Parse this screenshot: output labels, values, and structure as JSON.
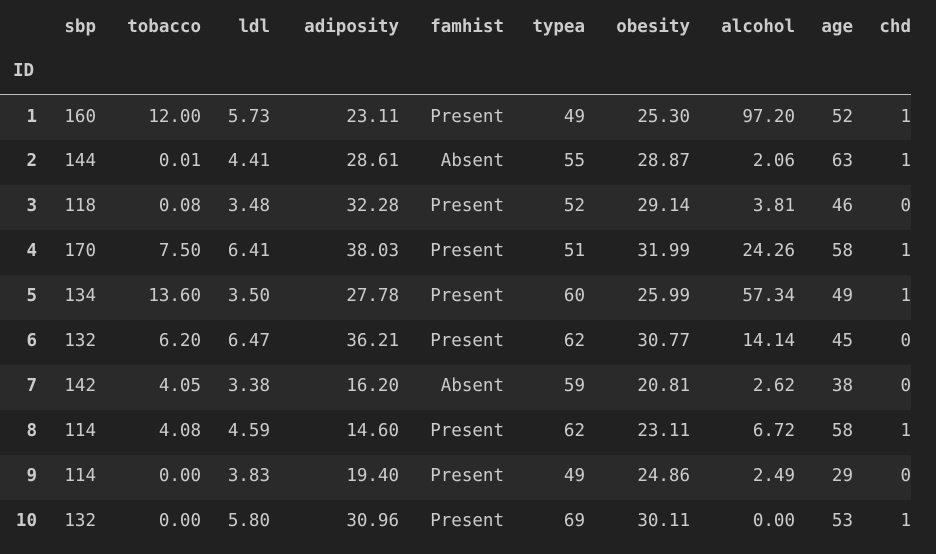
{
  "index_name": "ID",
  "columns": [
    "sbp",
    "tobacco",
    "ldl",
    "adiposity",
    "famhist",
    "typea",
    "obesity",
    "alcohol",
    "age",
    "chd"
  ],
  "rows": [
    {
      "id": "1",
      "sbp": "160",
      "tobacco": "12.00",
      "ldl": "5.73",
      "adiposity": "23.11",
      "famhist": "Present",
      "typea": "49",
      "obesity": "25.30",
      "alcohol": "97.20",
      "age": "52",
      "chd": "1"
    },
    {
      "id": "2",
      "sbp": "144",
      "tobacco": "0.01",
      "ldl": "4.41",
      "adiposity": "28.61",
      "famhist": "Absent",
      "typea": "55",
      "obesity": "28.87",
      "alcohol": "2.06",
      "age": "63",
      "chd": "1"
    },
    {
      "id": "3",
      "sbp": "118",
      "tobacco": "0.08",
      "ldl": "3.48",
      "adiposity": "32.28",
      "famhist": "Present",
      "typea": "52",
      "obesity": "29.14",
      "alcohol": "3.81",
      "age": "46",
      "chd": "0"
    },
    {
      "id": "4",
      "sbp": "170",
      "tobacco": "7.50",
      "ldl": "6.41",
      "adiposity": "38.03",
      "famhist": "Present",
      "typea": "51",
      "obesity": "31.99",
      "alcohol": "24.26",
      "age": "58",
      "chd": "1"
    },
    {
      "id": "5",
      "sbp": "134",
      "tobacco": "13.60",
      "ldl": "3.50",
      "adiposity": "27.78",
      "famhist": "Present",
      "typea": "60",
      "obesity": "25.99",
      "alcohol": "57.34",
      "age": "49",
      "chd": "1"
    },
    {
      "id": "6",
      "sbp": "132",
      "tobacco": "6.20",
      "ldl": "6.47",
      "adiposity": "36.21",
      "famhist": "Present",
      "typea": "62",
      "obesity": "30.77",
      "alcohol": "14.14",
      "age": "45",
      "chd": "0"
    },
    {
      "id": "7",
      "sbp": "142",
      "tobacco": "4.05",
      "ldl": "3.38",
      "adiposity": "16.20",
      "famhist": "Absent",
      "typea": "59",
      "obesity": "20.81",
      "alcohol": "2.62",
      "age": "38",
      "chd": "0"
    },
    {
      "id": "8",
      "sbp": "114",
      "tobacco": "4.08",
      "ldl": "4.59",
      "adiposity": "14.60",
      "famhist": "Present",
      "typea": "62",
      "obesity": "23.11",
      "alcohol": "6.72",
      "age": "58",
      "chd": "1"
    },
    {
      "id": "9",
      "sbp": "114",
      "tobacco": "0.00",
      "ldl": "3.83",
      "adiposity": "19.40",
      "famhist": "Present",
      "typea": "49",
      "obesity": "24.86",
      "alcohol": "2.49",
      "age": "29",
      "chd": "0"
    },
    {
      "id": "10",
      "sbp": "132",
      "tobacco": "0.00",
      "ldl": "5.80",
      "adiposity": "30.96",
      "famhist": "Present",
      "typea": "69",
      "obesity": "30.11",
      "alcohol": "0.00",
      "age": "53",
      "chd": "1"
    }
  ],
  "colors": {
    "background": "#212121",
    "row_stripe": "#2a2a2a",
    "text": "#cccccc",
    "header_rule": "#bdbdbd"
  }
}
